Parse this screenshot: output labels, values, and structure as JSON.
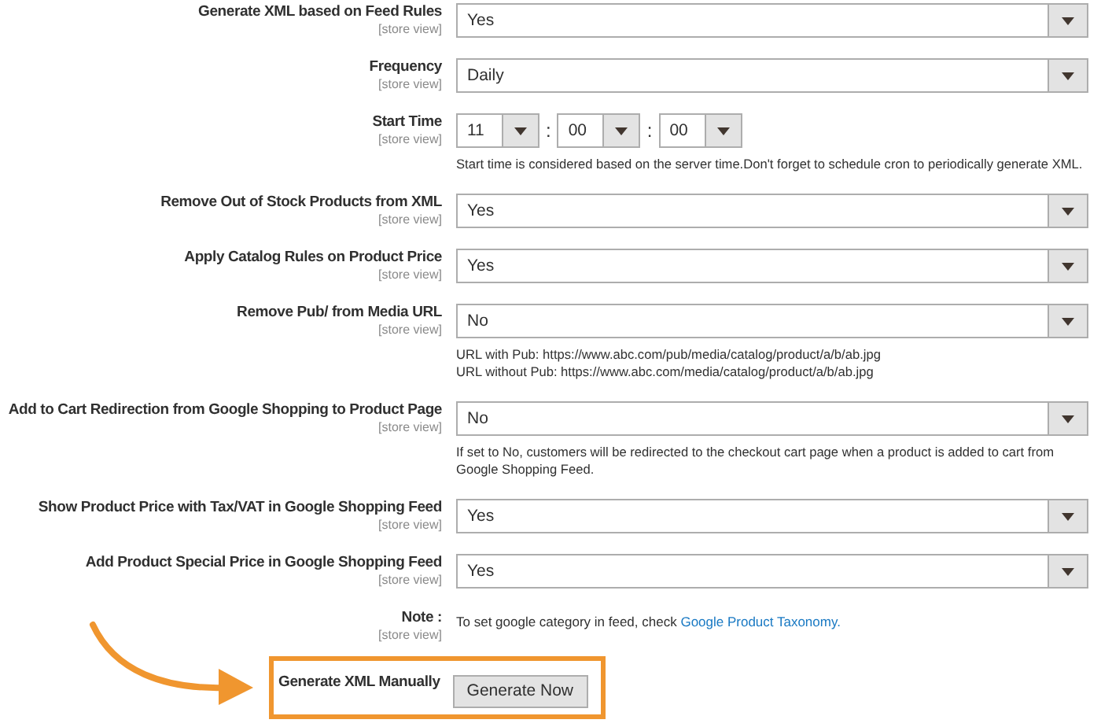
{
  "rows": [
    {
      "kind": "select",
      "label": "Generate XML based on Feed Rules",
      "scope": "[store view]",
      "value": "Yes"
    },
    {
      "kind": "select",
      "label": "Frequency",
      "scope": "[store view]",
      "value": "Daily"
    },
    {
      "kind": "time",
      "label": "Start Time",
      "scope": "[store view]",
      "parts": [
        "11",
        "00",
        "00"
      ],
      "separators": [
        ":",
        ":"
      ],
      "notes": [
        "Start time is considered based on the server time.Don't forget to schedule cron to periodically generate XML."
      ]
    },
    {
      "kind": "select",
      "label": "Remove Out of Stock Products from XML",
      "scope": "[store view]",
      "value": "Yes"
    },
    {
      "kind": "select",
      "label": "Apply Catalog Rules on Product Price",
      "scope": "[store view]",
      "value": "Yes"
    },
    {
      "kind": "select",
      "label": "Remove Pub/ from Media URL",
      "scope": "[store view]",
      "value": "No",
      "notes": [
        "URL with Pub: https://www.abc.com/pub/media/catalog/product/a/b/ab.jpg",
        "URL without Pub: https://www.abc.com/media/catalog/product/a/b/ab.jpg"
      ]
    },
    {
      "kind": "select",
      "label": "Add to Cart Redirection from Google Shopping to Product Page",
      "scope": "[store view]",
      "value": "No",
      "notes": [
        "If set to No, customers will be redirected to the checkout cart page when a product is added to cart from Google Shopping Feed."
      ]
    },
    {
      "kind": "select",
      "label": "Show Product Price with Tax/VAT in Google Shopping Feed",
      "scope": "[store view]",
      "value": "Yes"
    },
    {
      "kind": "select",
      "label": "Add Product Special Price in Google Shopping Feed",
      "scope": "[store view]",
      "value": "Yes"
    },
    {
      "kind": "note",
      "label": "Note :",
      "scope": "[store view]",
      "text": "To set google category in feed, check ",
      "link": "Google Product Taxonomy."
    },
    {
      "kind": "action",
      "label": "Generate XML Manually",
      "button": "Generate Now"
    }
  ]
}
